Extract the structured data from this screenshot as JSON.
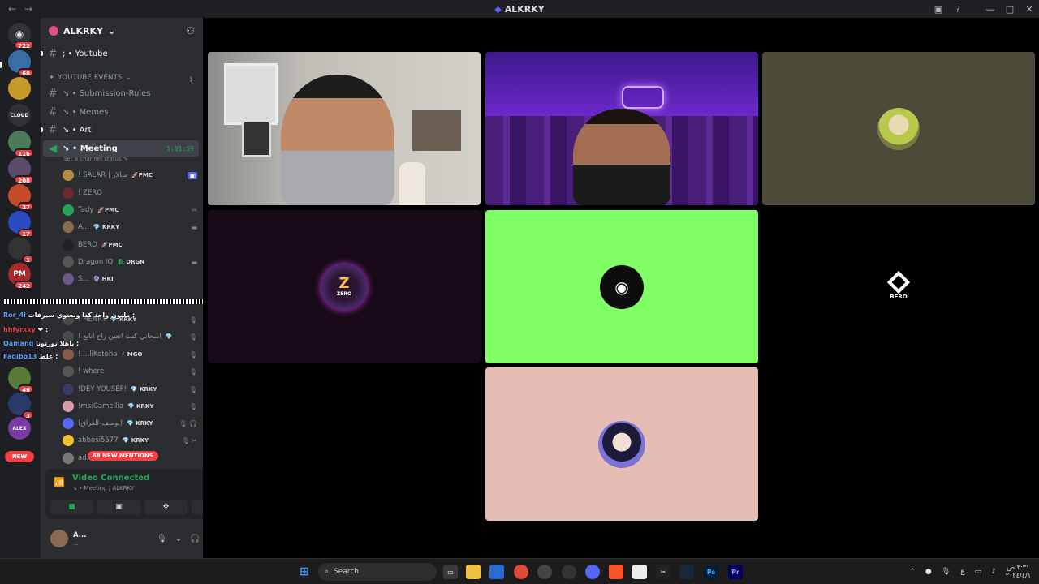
{
  "window": {
    "title": "ALKRKY",
    "back": "←",
    "forward": "→"
  },
  "rail": {
    "home_badge": "722",
    "servers": [
      {
        "badge": "68",
        "color": "#3a6ea5"
      },
      {
        "badge": "",
        "color": "#c79a2c"
      },
      {
        "badge": "",
        "color": "#2f3136",
        "text": "CLOUD"
      },
      {
        "badge": "116",
        "color": "#4a7a5a"
      },
      {
        "badge": "208",
        "color": "#5a4a6a"
      },
      {
        "badge": "27",
        "color": "#c44a2a"
      },
      {
        "badge": "17",
        "color": "#2a4ac4"
      },
      {
        "badge": "1",
        "color": "#333"
      },
      {
        "badge": "242",
        "color": "#a82a2a",
        "text": "PM"
      },
      {
        "badge": "46",
        "color": "#5a7a3a"
      },
      {
        "badge": "3",
        "color": "#2a3a6a"
      },
      {
        "badge": "",
        "color": "#7a3aa5",
        "text": "ALEX"
      }
    ],
    "new_label": "NEW"
  },
  "server": {
    "name": "ALKRKY"
  },
  "channels": {
    "youtube": "; • Youtube",
    "events_category": "YOUTUBE EVENTS",
    "submission": "↘ • Submission-Rules",
    "memes": "↘ • Memes",
    "art": "↘ • Art",
    "meeting": "↘ • Meeting",
    "meeting_time": "1:01:59",
    "status_hint": "Set a channel status ✎"
  },
  "members": [
    {
      "name": "! SALAR | سالار",
      "tag": "🚀PMC",
      "color": "#b58a3a",
      "right": "▣"
    },
    {
      "name": "! ZERO",
      "tag": "",
      "color": "#6a2a2a",
      "right": ""
    },
    {
      "name": "Tady",
      "tag": "🚀PMC",
      "color": "#23a559",
      "right": "✂"
    },
    {
      "name": "A...",
      "tag": "💎 KRKY",
      "color": "#8a6a50",
      "right": "▬"
    },
    {
      "name": "BERO",
      "tag": "🚀PMC",
      "color": "#222",
      "right": ""
    },
    {
      "name": "Dragon IQ",
      "tag": "🐉 DRGN",
      "color": "#555",
      "right": "▬"
    },
    {
      "name": "S...",
      "tag": "🔮 HKI",
      "color": "#6a5a8a",
      "right": ""
    },
    {
      "name": "! HENRY",
      "tag": "💎 KRKY",
      "color": "#4a4a4a",
      "right": "🎙"
    },
    {
      "name": "! اسحاني كنت اتعين زاح اتابع",
      "tag": "💎",
      "color": "#4a4a4a",
      "right": "🎙"
    },
    {
      "name": "! ...liKotoha",
      "tag": "⚡ MGO",
      "color": "#8a5a4a",
      "right": "🎙"
    },
    {
      "name": "! where",
      "tag": "",
      "color": "#555",
      "right": "🎙"
    },
    {
      "name": "!DEY YOUSEF!",
      "tag": "💎 KRKY",
      "color": "#3a3a6a",
      "right": "🎙"
    },
    {
      "name": "!ms:Camellia",
      "tag": "💎 KRKY",
      "color": "#d49aa5",
      "right": "🎙"
    },
    {
      "name": "(يوسف-العراق)",
      "tag": "💎 KRKY",
      "color": "#5865f2",
      "right": "🎙 🎧"
    },
    {
      "name": "abbosi5577",
      "tag": "💎 KRKY",
      "color": "#f0c030",
      "right": "🎙 ✂"
    },
    {
      "name": "ad...",
      "tag": "",
      "color": "#777",
      "right": ""
    }
  ],
  "new_mentions": "68 NEW MENTIONS",
  "overlay_chat": [
    {
      "name": "Ror_4l",
      "msg": "مليون واحد كذا وبسوي سيرفات :",
      "red": false
    },
    {
      "name": "hhfyrxky",
      "msg": "❤ :",
      "red": true
    },
    {
      "name": "Qamanq",
      "msg": "ياهلا نورتونا :",
      "red": false
    },
    {
      "name": "Fadibo13",
      "msg": "غلط :",
      "red": false
    }
  ],
  "voice": {
    "status": "Video Connected",
    "channel": "↘ • Meeting / ALKRKY"
  },
  "user": {
    "name": "A...",
    "sub": "..."
  },
  "tiles": [
    {
      "label": "",
      "kind": "camera-1"
    },
    {
      "label": "",
      "kind": "camera-2"
    },
    {
      "label": "",
      "kind": "avatar-olive"
    },
    {
      "label": "ZERO",
      "kind": "avatar-dark"
    },
    {
      "label": "",
      "kind": "discord-green"
    },
    {
      "label": "BERO",
      "kind": "avatar-black"
    },
    {
      "label": "",
      "kind": "avatar-pink"
    }
  ],
  "taskbar": {
    "search_placeholder": "Search",
    "time": "٣:٣١ ص",
    "date": "٢٠٢٤/٤/١"
  },
  "colors": {
    "discord_blurple": "#5865f2",
    "voice_green": "#23a559",
    "alert_red": "#f23f43",
    "green_tile": "#80ff66",
    "pink_tile": "#e6bdb5",
    "olive_tile": "#4c4b3a"
  }
}
